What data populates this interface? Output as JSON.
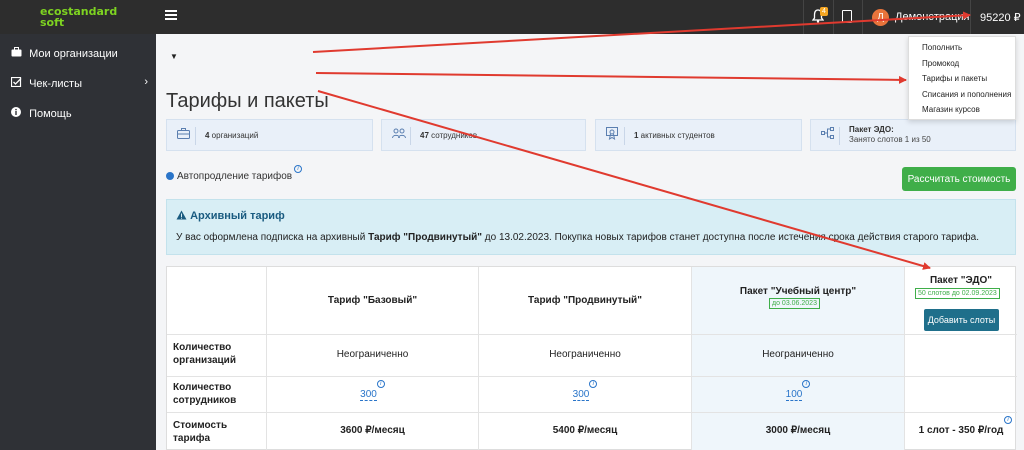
{
  "app": {
    "logo_line1": "ecostandard",
    "logo_line2": "soft"
  },
  "topbar": {
    "notification_count": "4",
    "avatar_letter": "Д",
    "user_name": "Демонстрация",
    "balance": "95220 ₽"
  },
  "sidebar": {
    "items": [
      {
        "label": "Мои организации",
        "icon": "briefcase-icon"
      },
      {
        "label": "Чек-листы",
        "icon": "checkbox-icon"
      },
      {
        "label": "Помощь",
        "icon": "info-icon"
      }
    ]
  },
  "page": {
    "title": "Тарифы и пакеты"
  },
  "stats": {
    "orgs_num": "4",
    "orgs_text": " организаций",
    "emp_num": "47",
    "emp_text": " сотрудников",
    "students_num": "1",
    "students_text": " активных студентов",
    "edo_title": "Пакет ЭДО:",
    "edo_text": "Занято слотов 1 из 50"
  },
  "controls": {
    "autorenew_label": "Автопродление тарифов",
    "info_glyph": "i",
    "calc_button": "Рассчитать стоимость"
  },
  "alert": {
    "title": "Архивный тариф",
    "text_before": "У вас оформлена подписка на архивный ",
    "tariff_name": "Тариф \"Продвинутый\"",
    "text_after": " до 13.02.2023. Покупка новых тарифов станет доступна после истечения срока действия старого тарифа."
  },
  "table": {
    "columns": [
      {
        "title": "Тариф \"Базовый\""
      },
      {
        "title": "Тариф \"Продвинутый\""
      },
      {
        "title": "Пакет \"Учебный центр\"",
        "badge": "до 03.06.2023"
      },
      {
        "title": "Пакет \"ЭДО\"",
        "badge": "50 слотов до 02.09.2023",
        "button": "Добавить слоты"
      }
    ],
    "rows": [
      {
        "label_1": "Количество",
        "label_2": "организаций",
        "values": [
          "Неограниченно",
          "Неограниченно",
          "Неограниченно",
          ""
        ]
      },
      {
        "label_1": "Количество",
        "label_2": "сотрудников",
        "values": [
          "300",
          "300",
          "100",
          ""
        ]
      },
      {
        "label_1": "Стоимость тарифа",
        "label_2": "",
        "values": [
          "3600 ₽/месяц",
          "5400 ₽/месяц",
          "3000 ₽/месяц",
          "1 слот - 350 ₽/год"
        ]
      }
    ]
  },
  "dropdown": {
    "items": [
      "Пополнить",
      "Промокод",
      "Тарифы и пакеты",
      "Списания и пополнения",
      "Магазин курсов"
    ]
  },
  "colors": {
    "accent_green": "#3fae49",
    "annotation_red": "#e03a2f",
    "primary_blue": "#2a75c9"
  }
}
